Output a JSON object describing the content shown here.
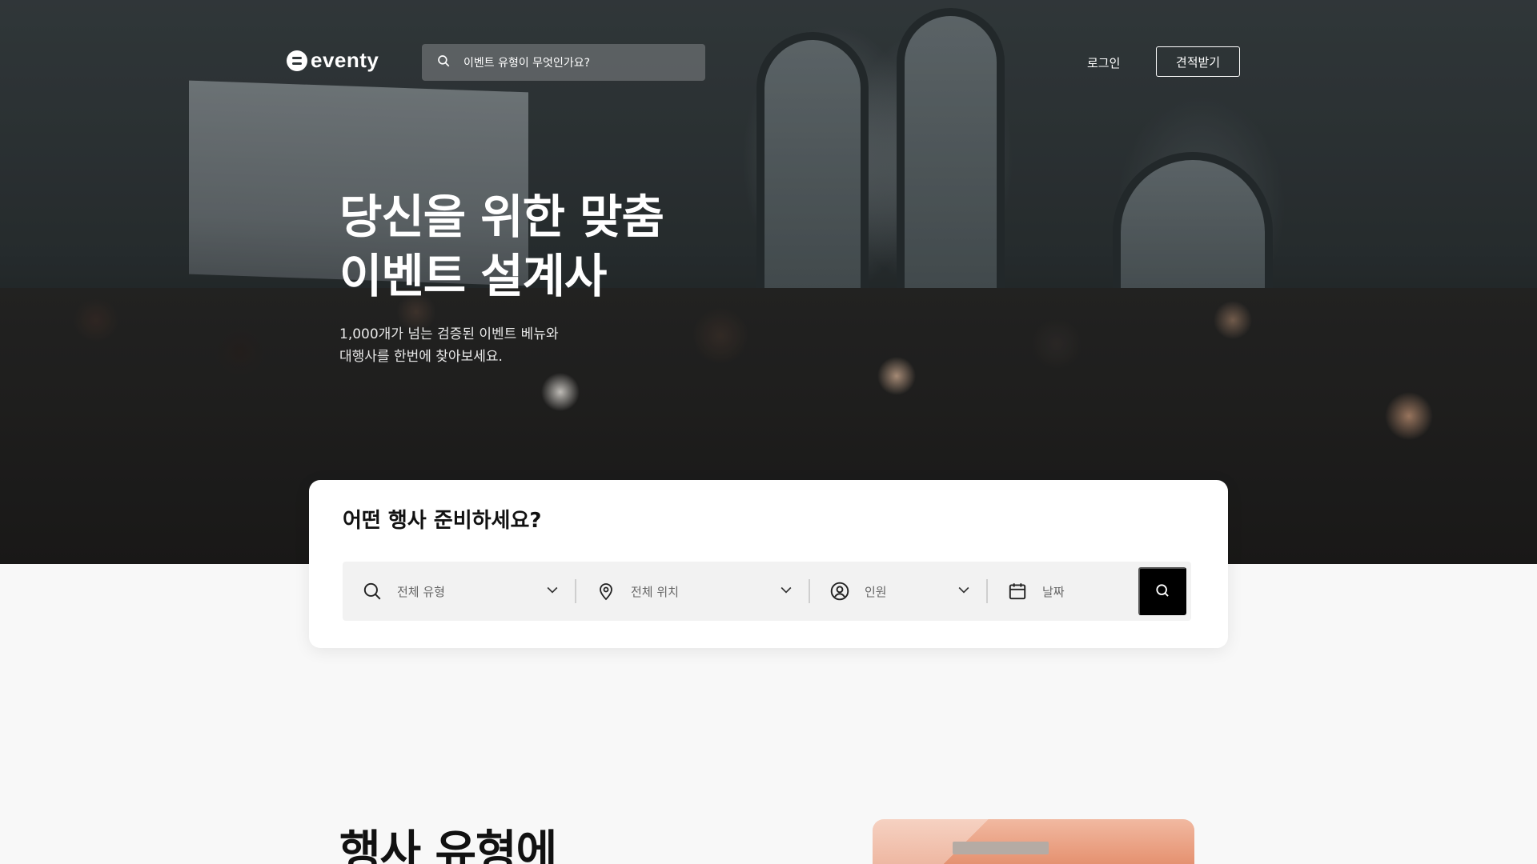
{
  "brand": {
    "name": "eventy",
    "logo_icon": "eventy-logo-icon"
  },
  "header": {
    "search_placeholder": "이벤트 유형이 무엇인가요?",
    "login_label": "로그인",
    "quote_button_label": "견적받기"
  },
  "hero": {
    "headline_line1": "당신을 위한 맞춤",
    "headline_line2": "이벤트 설계사",
    "sub_line1": "1,000개가 넘는 검증된 이벤트 베뉴와",
    "sub_line2": "대행사를 한번에 찾아보세요."
  },
  "search_card": {
    "title": "어떤 행사 준비하세요?",
    "filters": [
      {
        "icon": "search-icon",
        "label": "전체 유형",
        "dropdown": true
      },
      {
        "icon": "location-pin-icon",
        "label": "전체 위치",
        "dropdown": true
      },
      {
        "icon": "user-circle-icon",
        "label": "인원",
        "dropdown": true
      },
      {
        "icon": "calendar-icon",
        "label": "날짜",
        "dropdown": false
      }
    ],
    "submit_icon": "search-icon"
  },
  "section": {
    "title": "행사 유형에"
  },
  "colors": {
    "accent": "#000000",
    "card_bg": "#ffffff",
    "page_bg": "#f8f8f8"
  }
}
